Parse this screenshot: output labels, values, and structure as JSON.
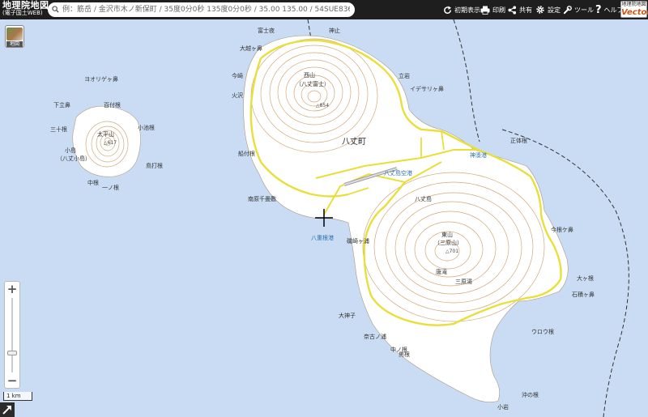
{
  "app": {
    "title": "地理院地図",
    "subtitle": "(電子国土WEB)",
    "logo_top": "地理院地図",
    "logo_bottom": "Vector"
  },
  "search": {
    "placeholder": "例：筋岳 / 金沢市木ノ新保町 / 35度0分0秒 135度0分0秒 / 35.00 135.00 / 54SUE83694920"
  },
  "toolbar": {
    "reset_label": "初期表示",
    "print_label": "印刷",
    "share_label": "共有",
    "settings_label": "設定",
    "tools_label": "ツール",
    "help_label": "ヘルプ"
  },
  "layer_button": {
    "label": "地図"
  },
  "zoom": {
    "in_label": "+",
    "out_label": "−",
    "level": 0.25
  },
  "scale_bar": {
    "label": "1 km"
  },
  "colors": {
    "sea": "#c9dcf3",
    "land": "#ffffff",
    "contour": "#d2a87a",
    "road": "#e9df3a",
    "toolbar": "#1e1e1e",
    "water_label": "#2a6fb0"
  },
  "map": {
    "town_label": "八丈町",
    "labels": {
      "l_otoriyagahama": "ヨオリゲヶ鼻",
      "l_shimotachi": "下立鼻",
      "l_momoari": "百付根",
      "l_sanjune": "三十根",
      "l_taiheizan": "太平山",
      "l_taiheizan_elev": "△617",
      "l_koike": "小池根",
      "l_kojima": "小島",
      "l_kojima_sub": "（八丈小島）",
      "l_tobako": "鳥打根",
      "l_nakane": "中根",
      "l_ichinone": "一ノ根",
      "l_nishiyama": "西山",
      "l_hachijofuji": "（八丈富士）",
      "l_fuji_elev": "△854",
      "l_oshioni": "大越ヶ鼻",
      "l_dozaki": "今崎",
      "l_kamogawa": "火沢",
      "l_funatsukine": "船付根",
      "l_nanbara": "南原千畳敷",
      "l_hashimokyodo": "八重根港",
      "l_tatemachi": "立岩",
      "l_izesaki": "イデサリヶ鼻",
      "l_kamiminato": "神湊港",
      "l_airport": "八丈島空港",
      "l_hachijoshima": "八丈島",
      "l_higashiyama": "東山",
      "l_mihara": "（三原山）",
      "l_mihara_elev": "△701",
      "l_karetaki": "唐滝",
      "l_miharayu": "三原湯",
      "l_taikine": "大神子",
      "l_nakanoura": "奈古ノ浦",
      "l_kuroiwa": "黒根",
      "l_keiyusaki": "今根ケ鼻",
      "l_ooyakehana": "大ヶ根",
      "l_ishizumi": "石積ヶ鼻",
      "l_uzuuhana": "ウロウ根",
      "l_okinone": "沖の根",
      "l_koiwa": "小岩",
      "l_seitaine": "正体根",
      "l_isogachi": "磯崎ヶ浦",
      "l_fujiyoto": "富士夜",
      "l_kamidoki": "神止",
      "l_nakane2": "中ノ根"
    }
  }
}
